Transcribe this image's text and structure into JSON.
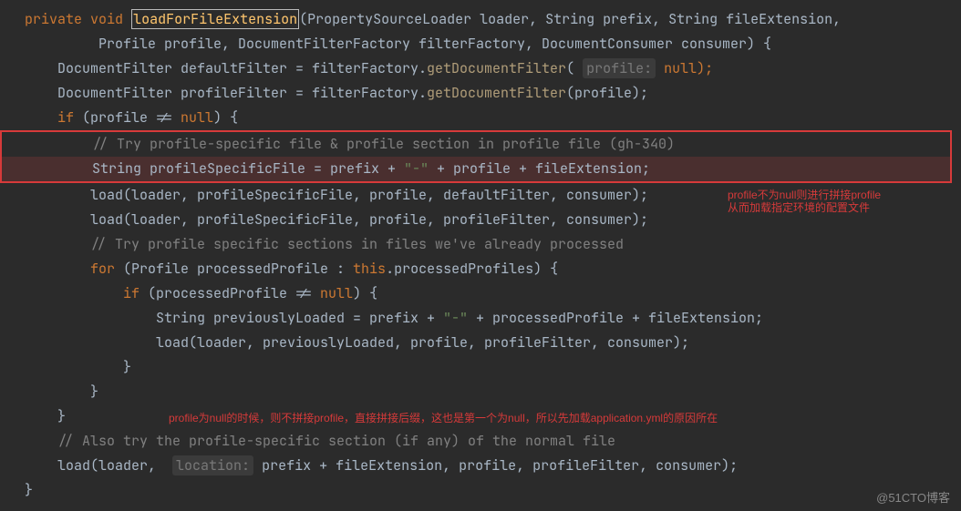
{
  "code": {
    "l1a": "private",
    "l1b": "void",
    "l1c": "loadForFileExtension",
    "l1d": "(PropertySourceLoader loader, String prefix, String fileExtension,",
    "l2": "Profile profile, DocumentFilterFactory filterFactory, DocumentConsumer consumer) {",
    "l3a": "DocumentFilter defaultFilter = filterFactory.",
    "l3fn": "getDocumentFilter",
    "l3b": "(",
    "hint1": "profile:",
    "l3c": " null);",
    "l4a": "DocumentFilter profileFilter = filterFactory.",
    "l4b": "(profile);",
    "l5a": "if",
    "l5b": " (profile != ",
    "l5kw": "null",
    "l5c": ") {",
    "c1": "// Try profile-specific file & profile section in profile file (gh-340)",
    "l7a": "String profileSpecificFile = prefix + ",
    "s1": "\"-\"",
    "l7b": " + profile + fileExtension;",
    "l8": "load(loader, profileSpecificFile, profile, defaultFilter, consumer);",
    "l9": "load(loader, profileSpecificFile, profile, profileFilter, consumer);",
    "c2": "// Try profile specific sections in files we've already processed",
    "l11a": "for",
    "l11b": " (Profile processedProfile : ",
    "l11c": "this",
    "l11d": ".processedProfiles) {",
    "l12a": "if",
    "l12b": " (processedProfile != ",
    "l12c": "null",
    "l12d": ") {",
    "l13a": "String previouslyLoaded = prefix + ",
    "l13b": " + processedProfile + fileExtension;",
    "l14": "load(loader, previouslyLoaded, profile, profileFilter, consumer);",
    "b1": "}",
    "c3": "// Also try the profile-specific section (if any) of the normal file",
    "l20a": "load(loader, ",
    "hint2": "location:",
    "l20b": " prefix + fileExtension, profile, profileFilter, consumer);"
  },
  "an1a": "profile不为null则进行拼接profile",
  "an1b": "从而加载指定环境的配置文件",
  "an2": "profile为null的时候，则不拼接profile，直接拼接后缀，这也是第一个为null，所以先加载application.yml的原因所在",
  "wm": "@51CTO博客"
}
